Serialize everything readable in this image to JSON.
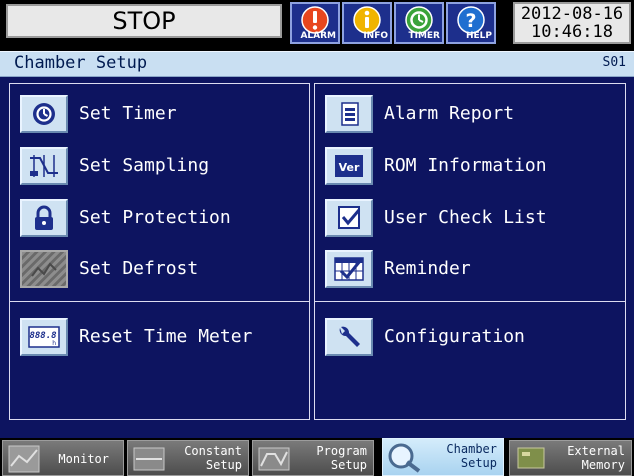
{
  "header": {
    "status": "STOP",
    "buttons": [
      {
        "label": "ALARM",
        "icon": "alarm-icon"
      },
      {
        "label": "INFO",
        "icon": "info-icon"
      },
      {
        "label": "TIMER",
        "icon": "timer-icon"
      },
      {
        "label": "HELP",
        "icon": "help-icon"
      }
    ],
    "date": "2012-08-16",
    "time": "10:46:18"
  },
  "title": {
    "text": "Chamber Setup",
    "code": "S01"
  },
  "left_menu": [
    {
      "label": "Set Timer",
      "icon": "timer-icon"
    },
    {
      "label": "Set Sampling",
      "icon": "sampling-icon"
    },
    {
      "label": "Set Protection",
      "icon": "lock-icon"
    },
    {
      "label": "Set Defrost",
      "icon": "defrost-icon"
    }
  ],
  "left_bottom": {
    "label": "Reset Time Meter",
    "icon": "time-meter-icon",
    "icon_text": "888.8",
    "icon_unit": "h"
  },
  "right_menu": [
    {
      "label": "Alarm Report",
      "icon": "report-icon"
    },
    {
      "label": "ROM Information",
      "icon": "ver-icon",
      "icon_text": "Ver"
    },
    {
      "label": "User Check List",
      "icon": "checklist-icon"
    },
    {
      "label": "Reminder",
      "icon": "reminder-icon"
    }
  ],
  "right_bottom": {
    "label": "Configuration",
    "icon": "wrench-icon"
  },
  "tabs": [
    {
      "line1": "Monitor",
      "line2": "",
      "active": false
    },
    {
      "line1": "Constant",
      "line2": "Setup",
      "active": false
    },
    {
      "line1": "Program",
      "line2": "Setup",
      "active": false
    },
    {
      "line1": "Chamber",
      "line2": "Setup",
      "active": true
    },
    {
      "line1": "External",
      "line2": "Memory",
      "active": false
    }
  ],
  "colors": {
    "background": "#0d1460",
    "title_strip": "#c9dff2",
    "tab_active": "#a9d3f0",
    "alarm": "#e8461e",
    "info": "#f0b400",
    "timer": "#3aa33a",
    "help": "#1f6fd0"
  }
}
